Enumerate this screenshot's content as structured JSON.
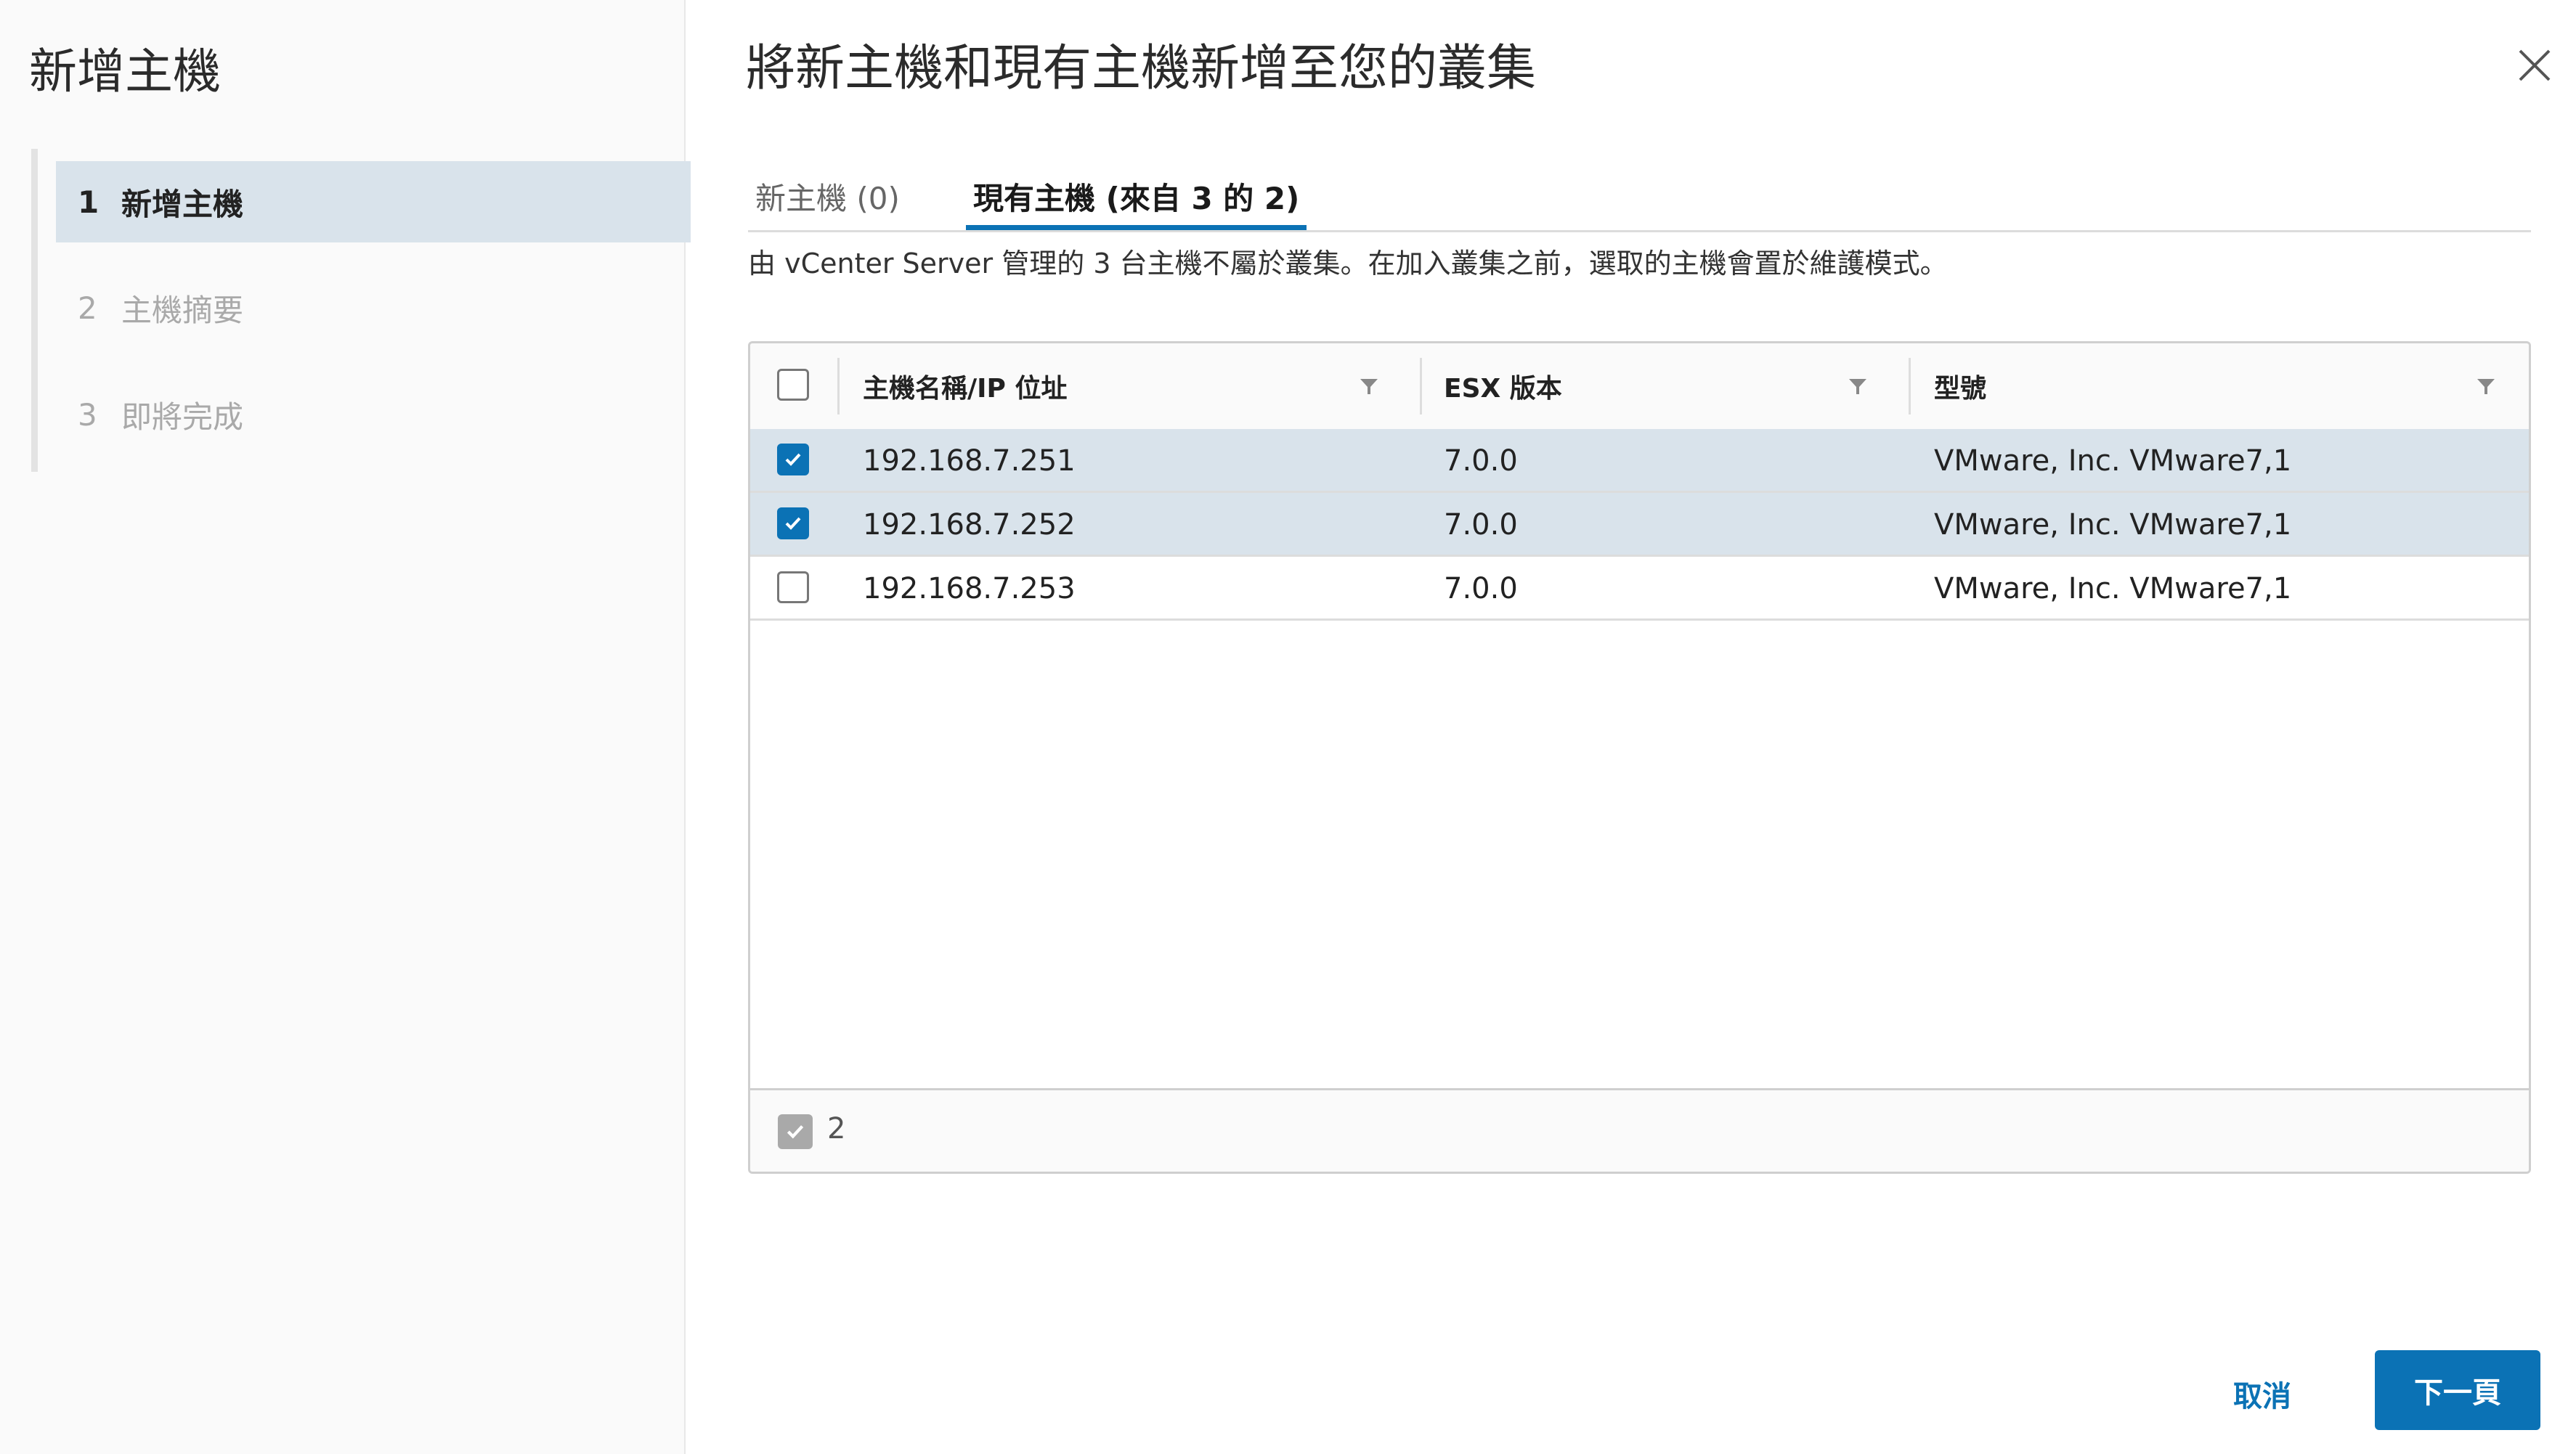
{
  "sidebar": {
    "title": "新增主機",
    "steps": [
      {
        "num": "1",
        "label": "新增主機"
      },
      {
        "num": "2",
        "label": "主機摘要"
      },
      {
        "num": "3",
        "label": "即將完成"
      }
    ]
  },
  "main": {
    "title": "將新主機和現有主機新增至您的叢集",
    "tabs": [
      {
        "label": "新主機 (0)"
      },
      {
        "label": "現有主機 (來自 3 的 2)"
      }
    ],
    "description": "由 vCenter Server 管理的 3 台主機不屬於叢集。在加入叢集之前，選取的主機會置於維護模式。"
  },
  "grid": {
    "columns": [
      "主機名稱/IP 位址",
      "ESX 版本",
      "型號"
    ],
    "rows": [
      {
        "host": "192.168.7.251",
        "esx": "7.0.0",
        "model": "VMware, Inc. VMware7,1",
        "selected": true
      },
      {
        "host": "192.168.7.252",
        "esx": "7.0.0",
        "model": "VMware, Inc. VMware7,1",
        "selected": true
      },
      {
        "host": "192.168.7.253",
        "esx": "7.0.0",
        "model": "VMware, Inc. VMware7,1",
        "selected": false
      }
    ],
    "selected_count": "2"
  },
  "buttons": {
    "cancel": "取消",
    "next": "下一頁"
  },
  "icons": {
    "close": "close-icon",
    "filter": "filter-icon",
    "check": "check-icon"
  },
  "colors": {
    "accent": "#0b72b5",
    "selected_row": "#d9e3eb"
  }
}
